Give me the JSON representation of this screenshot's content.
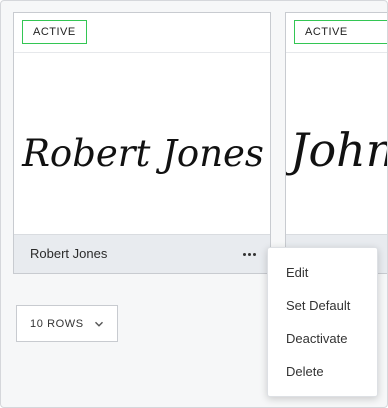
{
  "cards": [
    {
      "status": "ACTIVE",
      "signature_text": "Robert Jones",
      "holder_name": "Robert Jones"
    },
    {
      "status": "ACTIVE",
      "signature_text": "John",
      "holder_name": ""
    }
  ],
  "more_icon": "ellipsis-horizontal-icon",
  "pagination": {
    "rows_label": "10 ROWS",
    "chevron_icon": "chevron-down-icon"
  },
  "context_menu": {
    "items": [
      "Edit",
      "Set Default",
      "Deactivate",
      "Delete"
    ]
  },
  "colors": {
    "active_border": "#33c653",
    "footer_bg": "#e8ebef",
    "page_bg": "#f6f7f8"
  }
}
